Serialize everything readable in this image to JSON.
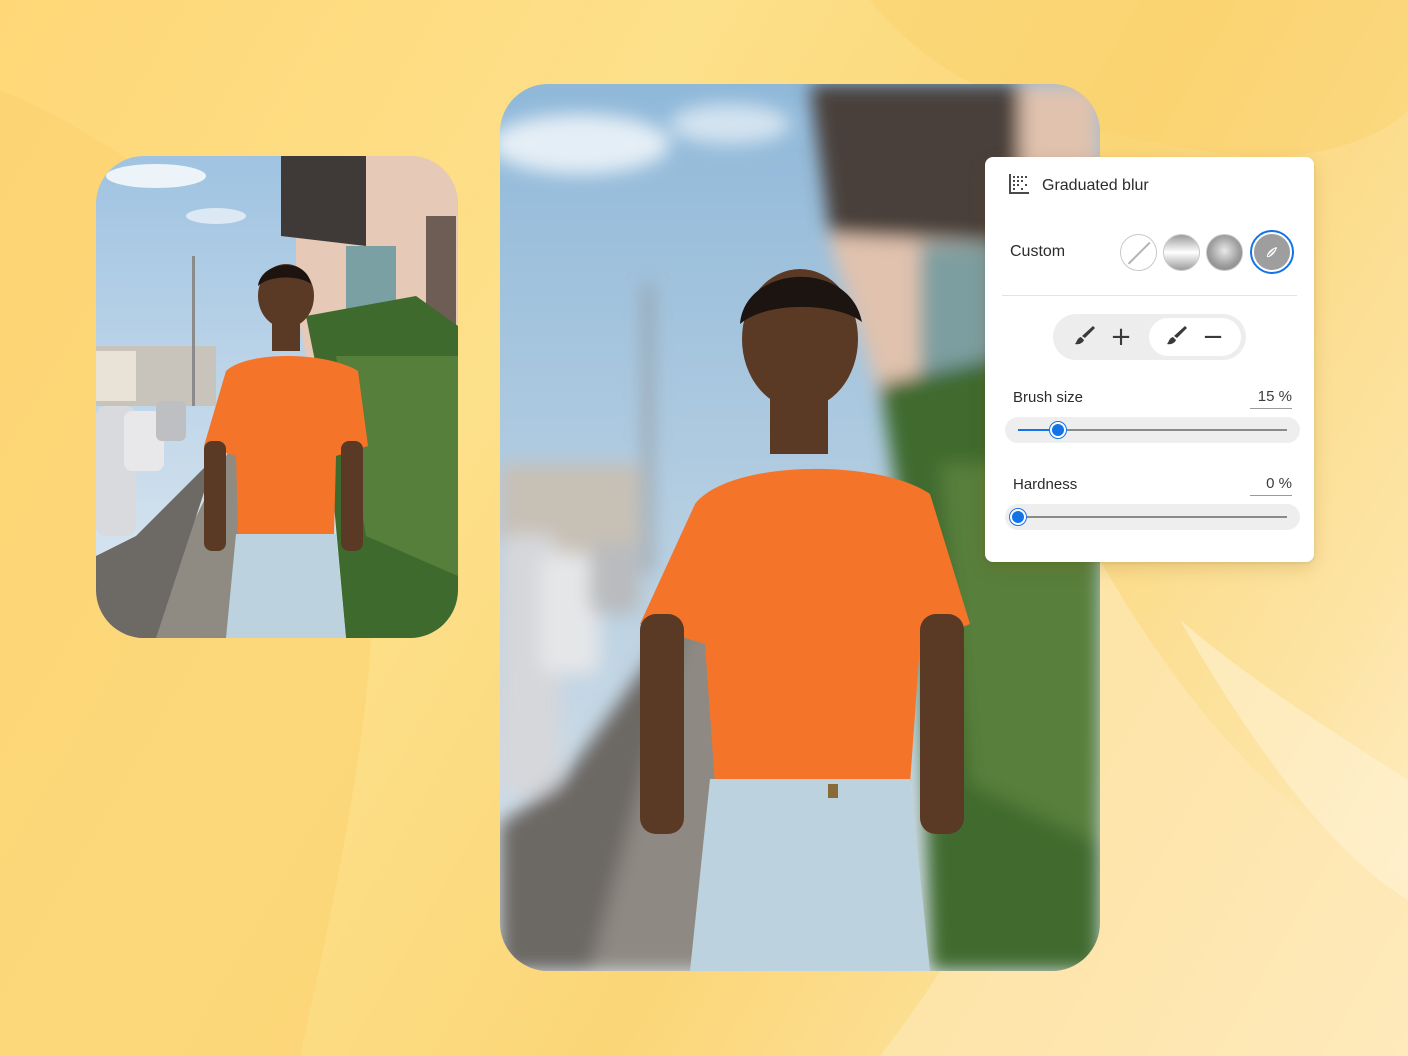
{
  "panel": {
    "title": "Graduated blur",
    "title_icon": "graduated-blur-icon",
    "preset_label": "Custom",
    "presets": [
      {
        "name": "none",
        "icon": "no-blur-icon"
      },
      {
        "name": "linear",
        "icon": "linear-gradient-icon"
      },
      {
        "name": "radial",
        "icon": "radial-gradient-icon"
      },
      {
        "name": "custom",
        "icon": "custom-brush-icon",
        "selected": true
      }
    ],
    "brush_modes": [
      {
        "mode": "add",
        "icon": "brush-icon",
        "symbol": "+"
      },
      {
        "mode": "subtract",
        "icon": "brush-icon",
        "symbol": "−",
        "active": true
      }
    ],
    "brush_size": {
      "label": "Brush size",
      "value_text": "15 %",
      "value": 15,
      "max": 100
    },
    "hardness": {
      "label": "Hardness",
      "value_text": "0 %",
      "value": 0,
      "max": 100
    }
  },
  "colors": {
    "accent": "#1473e6",
    "background": "#fcd979",
    "shirt": "#f4752a",
    "jeans": "#bcd2de"
  }
}
